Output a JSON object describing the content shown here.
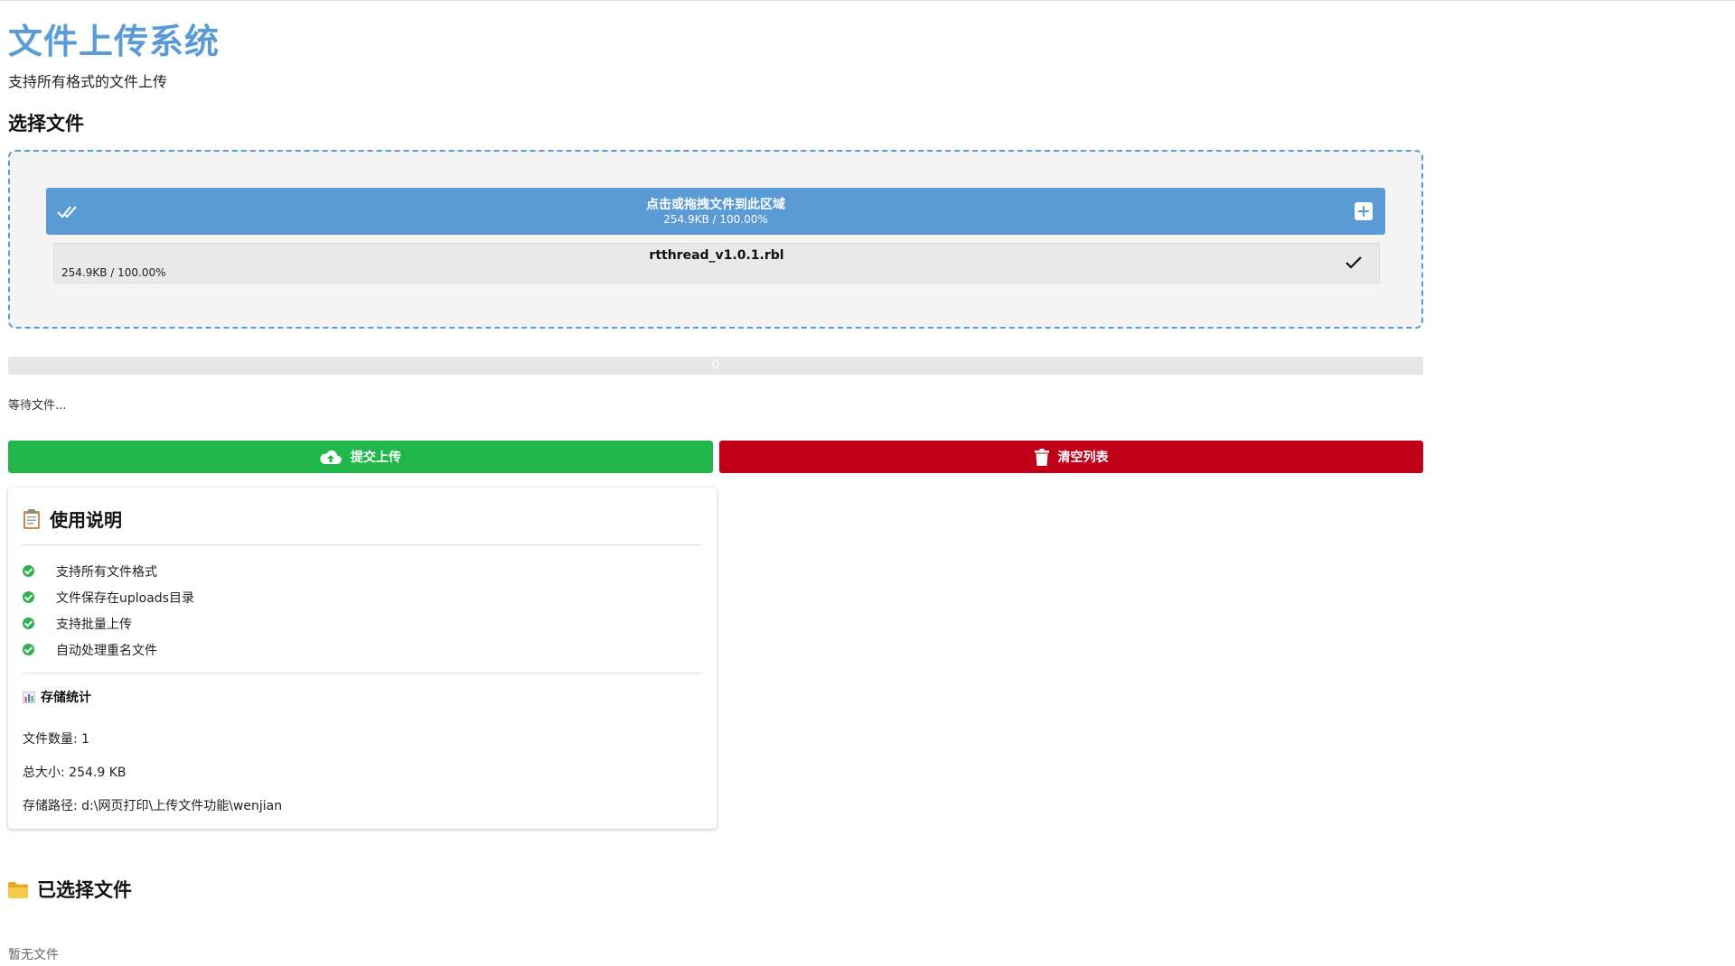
{
  "header": {
    "title": "文件上传系统",
    "subtitle": "支持所有格式的文件上传"
  },
  "select_section": {
    "heading": "选择文件"
  },
  "dropzone": {
    "title": "点击或拖拽文件到此区域",
    "summary": "254.9KB / 100.00%",
    "files": [
      {
        "name": "rtthread_v1.0.1.rbl",
        "size": "254.9KB / 100.00%"
      }
    ]
  },
  "progress": {
    "value": 0,
    "text": "0"
  },
  "status": "等待文件...",
  "buttons": {
    "upload": "提交上传",
    "clear": "清空列表"
  },
  "colors": {
    "accent": "#5b9bd5",
    "upload": "#22b74a",
    "clear": "#c00018",
    "check": "#2db14f"
  },
  "instructions": {
    "title": "使用说明",
    "icon": "clipboard-icon",
    "items": [
      "支持所有文件格式",
      "文件保存在uploads目录",
      "支持批量上传",
      "自动处理重名文件"
    ]
  },
  "stats": {
    "title": "存储统计",
    "icon": "bar-chart-icon",
    "file_count": "文件数量: 1",
    "total_size": "总大小: 254.9 KB",
    "path": "存储路径: d:\\网页打印\\上传文件功能\\wenjian"
  },
  "selected": {
    "title": "已选择文件",
    "icon": "folder-icon",
    "empty": "暂无文件"
  }
}
